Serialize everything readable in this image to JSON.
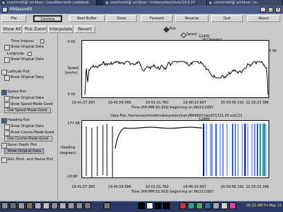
{
  "terminals": [
    "vzschmidt@ vzl-blue:~/sandbox-bmk-cookbook",
    "vzschmidt@ vzl-blue:~/mikesystem/lsshi/16.6.07",
    "vzschmidt@ vzl-blue:~/s..."
  ],
  "window_title": "MIdasvedit",
  "menu": {
    "file": "File",
    "controls": "Controls",
    "next_buffer": "Next Buffer",
    "done": "Done",
    "forward": "Forward",
    "reverse": "Reverse",
    "quit": "Quit",
    "about": "About"
  },
  "toolbar": {
    "show_all": "Show All",
    "pick_zoom": "Pick Zoom",
    "interpolate": "Interpolate",
    "revert": "Revert"
  },
  "mode": {
    "pick": "Pick",
    "select": "Select",
    "deselect": "Deselect",
    "select_all": "Select All",
    "deselect_all": "Deselect All"
  },
  "left_panel": {
    "time_interval": "Time Interval",
    "show_original_1": "Show Original Data",
    "longitude": "Longitude",
    "show_original_2": "Show Original Data",
    "latitude_plot": "Latitude Plot",
    "show_original_3": "Show Original Data",
    "speed_plot": "Speed Plot",
    "show_original_4": "Show Original Data",
    "show_speed_made_good": "Show Speed-Made-Good",
    "use_speed_made_good": "Use Speed-Made-Good",
    "heading_plot": "Heading Plot",
    "show_original_5": "Show Original Data",
    "show_course_made_good": "Show Course-Made-Good",
    "use_course_made_good": "Use Course-Made-Good",
    "sonar_depth_plot": "Sonar Depth Plot",
    "show_original_6": "Show Original Data",
    "roll_pitch_heave": "Roll, Pitch, and Heave Plot"
  },
  "speed_plot": {
    "ylabel_top": "Speed",
    "ylabel_bottom": "(km/hr)",
    "ytick_top": "0.00",
    "ytick_bottom": "0.00",
    "top_readout": "12400",
    "xticks": [
      "19:41:07.393",
      "19:45:54.586",
      "20:01:01.782",
      "19:40:20.997",
      "20:30:56.192",
      "22:33:23.386"
    ],
    "xcaption": "Time (HH:MM:SS.SSS) beginning on 06/21/1997"
  },
  "heading_plot": {
    "datafile": "Data File: /home/vzschmidt/mikesystem/lsshi/RR6897/nbs971721.05.mb121",
    "ylabel_top": "Heading",
    "ylabel_bottom": "(degrees)",
    "ytick_top": "177.98",
    "ytick_bottom": "-10.68",
    "top_readout": "12400",
    "xticks": [
      "19:41:07.393",
      "19:45:54.586",
      "20:01:01.782",
      "19:40:20.997",
      "20:30:56.192",
      "22:33:23.386"
    ],
    "xcaption": "Time (HH:MM:SS.SSS) beginning on 06/21/1997"
  },
  "clock": "05:22 AM Fri May 11"
}
